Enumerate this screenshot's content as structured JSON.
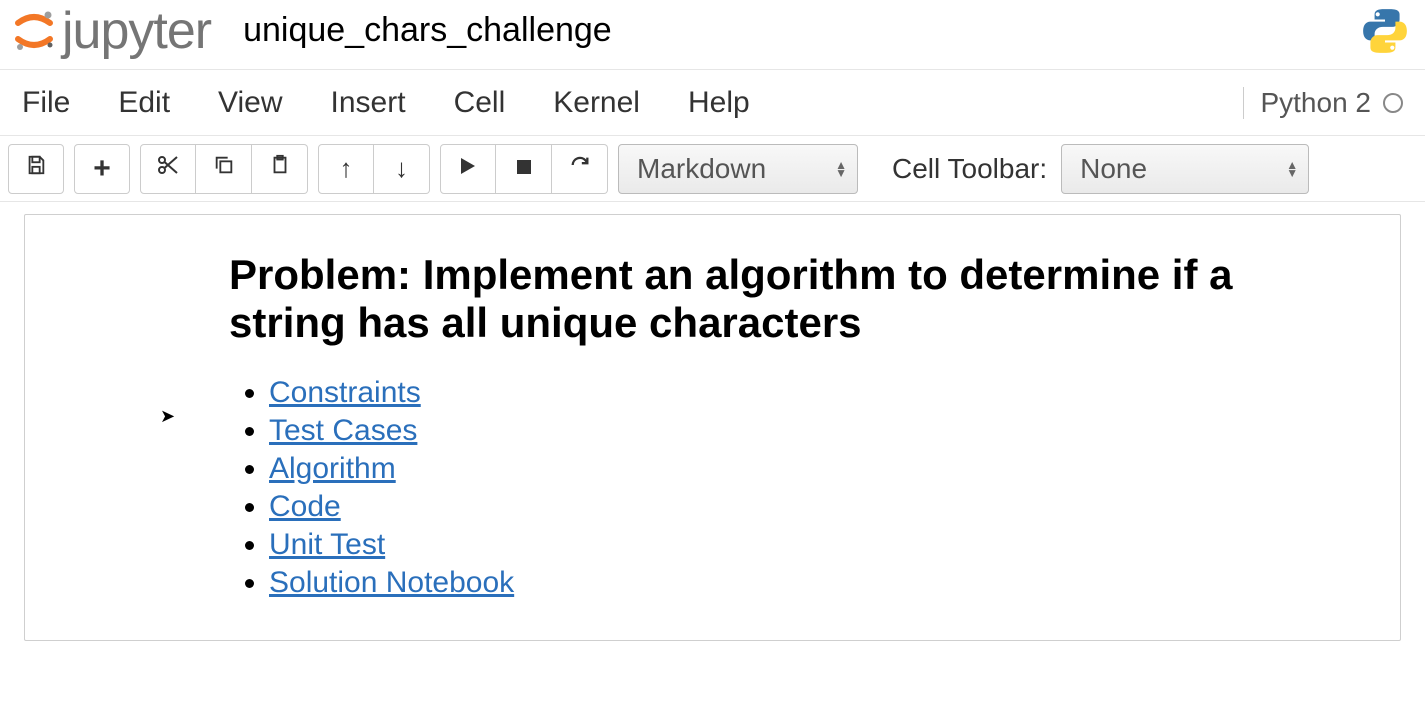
{
  "header": {
    "logo_text": "jupyter",
    "notebook_name": "unique_chars_challenge"
  },
  "menubar": {
    "items": [
      "File",
      "Edit",
      "View",
      "Insert",
      "Cell",
      "Kernel",
      "Help"
    ],
    "kernel_name": "Python 2"
  },
  "toolbar": {
    "celltype_selected": "Markdown",
    "cell_toolbar_label": "Cell Toolbar:",
    "cell_toolbar_selected": "None"
  },
  "cell": {
    "heading": "Problem: Implement an algorithm to determine if a string has all unique characters",
    "links": [
      "Constraints",
      "Test Cases",
      "Algorithm",
      "Code",
      "Unit Test",
      "Solution Notebook"
    ]
  }
}
